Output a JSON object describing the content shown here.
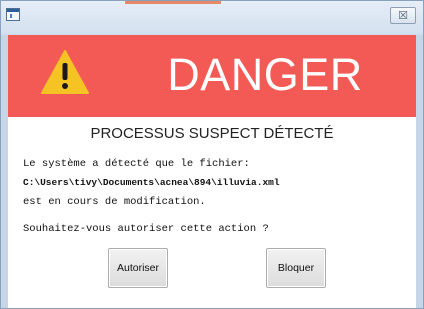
{
  "window": {
    "title": "",
    "close_label": "☒"
  },
  "banner": {
    "icon": "warning-triangle-icon",
    "title": "DANGER",
    "background_color": "#f45a55",
    "icon_color": "#f6c325"
  },
  "dialog": {
    "heading": "PROCESSUS SUSPECT DÉTECTÉ",
    "line1": "Le système a détecté que le fichier:",
    "file_path": "C:\\Users\\tivy\\Documents\\acnea\\894\\illuvia.xml",
    "line3": "est en cours de modification.",
    "question": "Souhaitez-vous autoriser cette action ?"
  },
  "buttons": {
    "allow_label": "Autoriser",
    "block_label": "Bloquer"
  }
}
